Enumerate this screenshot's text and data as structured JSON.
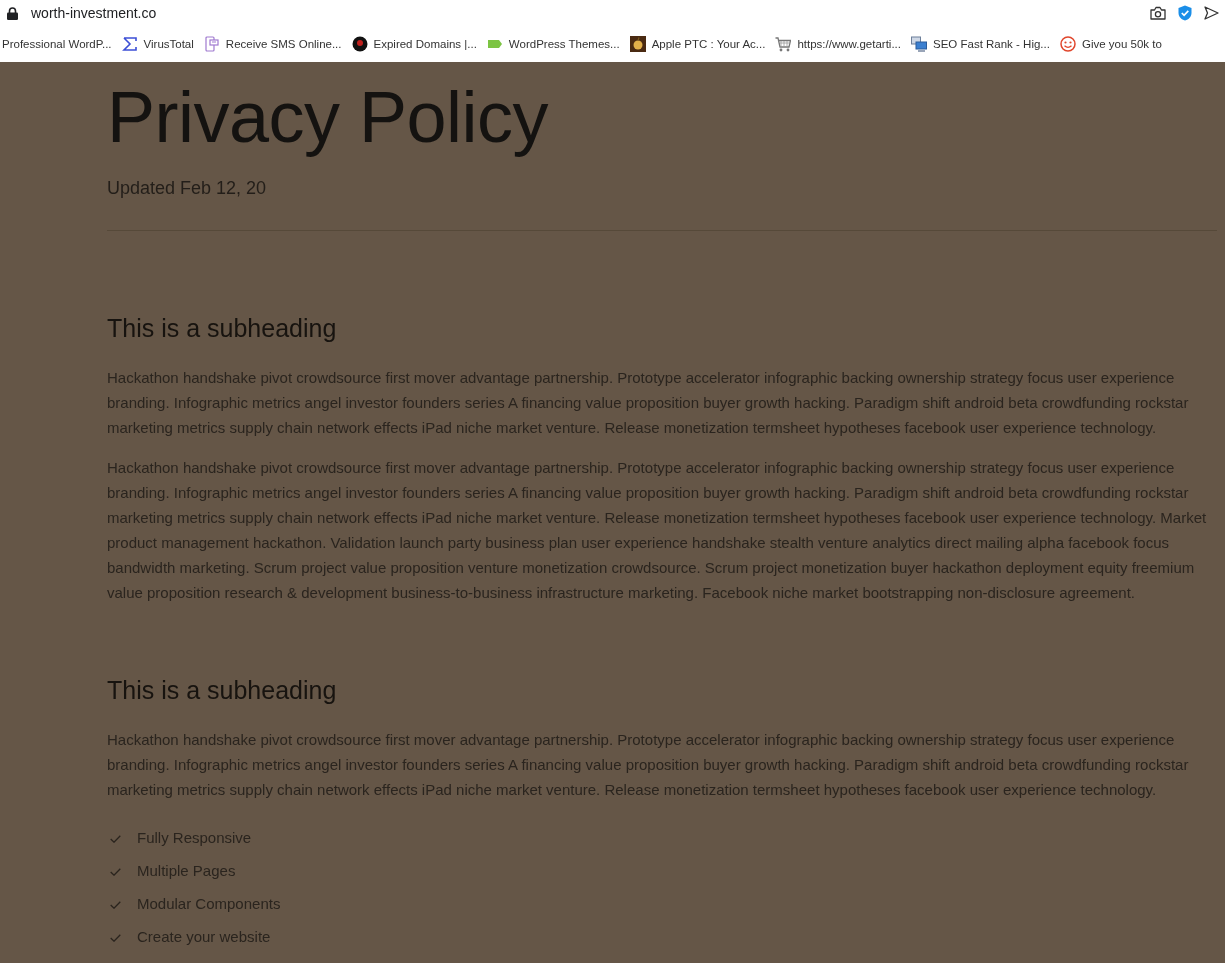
{
  "browser": {
    "address": "worth-investment.co",
    "bookmarks": [
      {
        "label": "Professional WordP...",
        "kind": "plain"
      },
      {
        "label": "VirusTotal",
        "kind": "sigma"
      },
      {
        "label": "Receive SMS Online...",
        "kind": "phone"
      },
      {
        "label": "Expired Domains |...",
        "kind": "ball"
      },
      {
        "label": "WordPress Themes...",
        "kind": "tag"
      },
      {
        "label": "Apple PTC : Your Ac...",
        "kind": "picture"
      },
      {
        "label": "https://www.getarti...",
        "kind": "cart"
      },
      {
        "label": "SEO Fast Rank - Hig...",
        "kind": "computer"
      },
      {
        "label": "Give you 50k to",
        "kind": "smiley"
      }
    ]
  },
  "page": {
    "title": "Privacy Policy",
    "updated": "Updated Feb 12, 20",
    "sections": [
      {
        "heading": "This is a subheading",
        "paragraphs": [
          "Hackathon handshake pivot crowdsource first mover advantage partnership. Prototype accelerator infographic backing ownership strategy focus user experience branding. Infographic metrics angel investor founders series A financing value proposition buyer growth hacking. Paradigm shift android beta crowdfunding rockstar marketing metrics supply chain network effects iPad niche market venture. Release monetization termsheet hypotheses facebook user experience technology.",
          "Hackathon handshake pivot crowdsource first mover advantage partnership. Prototype accelerator infographic backing ownership strategy focus user experience branding. Infographic metrics angel investor founders series A financing value proposition buyer growth hacking. Paradigm shift android beta crowdfunding rockstar marketing metrics supply chain network effects iPad niche market venture. Release monetization termsheet hypotheses facebook user experience technology. Market product management hackathon. Validation launch party business plan user experience handshake stealth venture analytics direct mailing alpha facebook focus bandwidth marketing. Scrum project value proposition venture monetization crowdsource. Scrum project monetization buyer hackathon deployment equity freemium value proposition research & development business-to-business infrastructure marketing. Facebook niche market bootstrapping non-disclosure agreement."
        ]
      },
      {
        "heading": "This is a subheading",
        "paragraphs": [
          "Hackathon handshake pivot crowdsource first mover advantage partnership. Prototype accelerator infographic backing ownership strategy focus user experience branding. Infographic metrics angel investor founders series A financing value proposition buyer growth hacking. Paradigm shift android beta crowdfunding rockstar marketing metrics supply chain network effects iPad niche market venture. Release monetization termsheet hypotheses facebook user experience technology."
        ],
        "checklist": [
          "Fully Responsive",
          "Multiple Pages",
          "Modular Components",
          "Create your website"
        ]
      }
    ]
  }
}
